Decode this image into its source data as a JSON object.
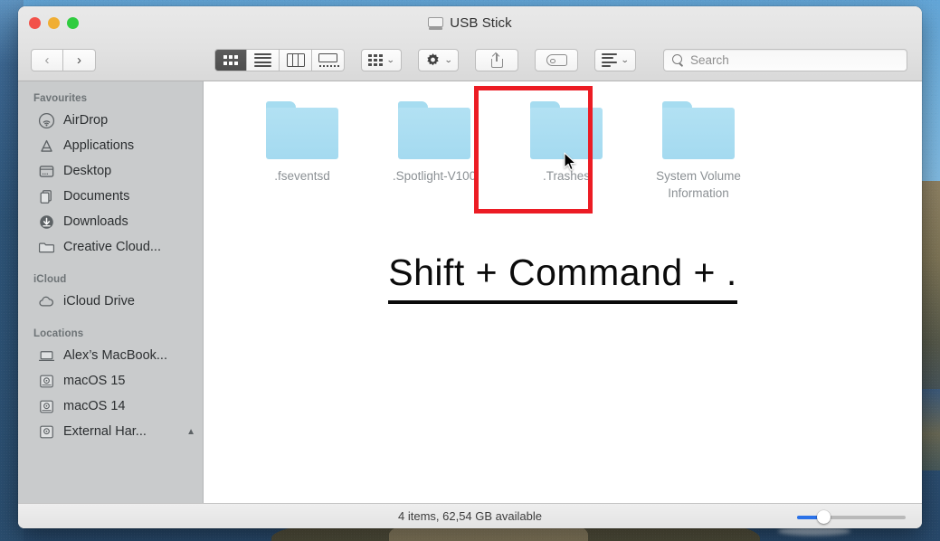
{
  "window": {
    "title": "USB Stick",
    "title_icon": "drive-icon",
    "traffic_lights": {
      "close": "#f2514a",
      "minimize": "#f0ae34",
      "maximize": "#2fcc3f"
    }
  },
  "toolbar": {
    "back_label": "‹",
    "forward_label": "›",
    "view_buttons": [
      {
        "name": "icon-view",
        "icon": "grid-icon",
        "active": true
      },
      {
        "name": "list-view",
        "icon": "list-icon",
        "active": false
      },
      {
        "name": "column-view",
        "icon": "columns-icon",
        "active": false
      },
      {
        "name": "gallery-view",
        "icon": "gallery-icon",
        "active": false
      }
    ],
    "group_button": {
      "name": "group-items",
      "icon": "grid-small-icon"
    },
    "action_button": {
      "name": "action-menu",
      "icon": "gear-icon"
    },
    "share_button": {
      "name": "share",
      "icon": "share-icon"
    },
    "tag_button": {
      "name": "edit-tags",
      "icon": "tag-icon"
    },
    "arrange_button": {
      "name": "arrange-by",
      "icon": "sort-icon"
    },
    "chevron": "⌄"
  },
  "search": {
    "placeholder": "Search",
    "value": "",
    "icon": "search-icon"
  },
  "sidebar": {
    "sections": [
      {
        "header": "Favourites",
        "items": [
          {
            "label": "AirDrop",
            "icon": "airdrop-icon"
          },
          {
            "label": "Applications",
            "icon": "applications-icon"
          },
          {
            "label": "Desktop",
            "icon": "desktop-icon"
          },
          {
            "label": "Documents",
            "icon": "documents-icon"
          },
          {
            "label": "Downloads",
            "icon": "downloads-icon"
          },
          {
            "label": "Creative Cloud...",
            "icon": "folder-icon"
          }
        ]
      },
      {
        "header": "iCloud",
        "items": [
          {
            "label": "iCloud Drive",
            "icon": "cloud-icon"
          }
        ]
      },
      {
        "header": "Locations",
        "items": [
          {
            "label": "Alex’s MacBook...",
            "icon": "laptop-icon"
          },
          {
            "label": "macOS 15",
            "icon": "hard-drive-icon"
          },
          {
            "label": "macOS 14",
            "icon": "hard-drive-icon"
          },
          {
            "label": "External Har...",
            "icon": "hard-drive-icon",
            "eject": "▲"
          }
        ]
      }
    ]
  },
  "files": [
    {
      "name": ".fseventsd",
      "icon": "folder-icon",
      "hidden": true
    },
    {
      "name": ".Spotlight-V100",
      "icon": "folder-icon",
      "hidden": true
    },
    {
      "name": ".Trashes",
      "icon": "folder-icon",
      "hidden": true,
      "highlighted": true
    },
    {
      "name": "System Volume Information",
      "icon": "folder-icon",
      "hidden": true
    }
  ],
  "annotation": {
    "shortcut_text": "Shift + Command + .",
    "highlight_color": "#ec1c24"
  },
  "statusbar": {
    "text": "4 items, 62,54 GB available",
    "zoom_slider": {
      "value": 20,
      "min": 0,
      "max": 100,
      "fill_color": "#2b72e8"
    }
  },
  "cursor": {
    "icon": "arrow-pointer-icon"
  }
}
